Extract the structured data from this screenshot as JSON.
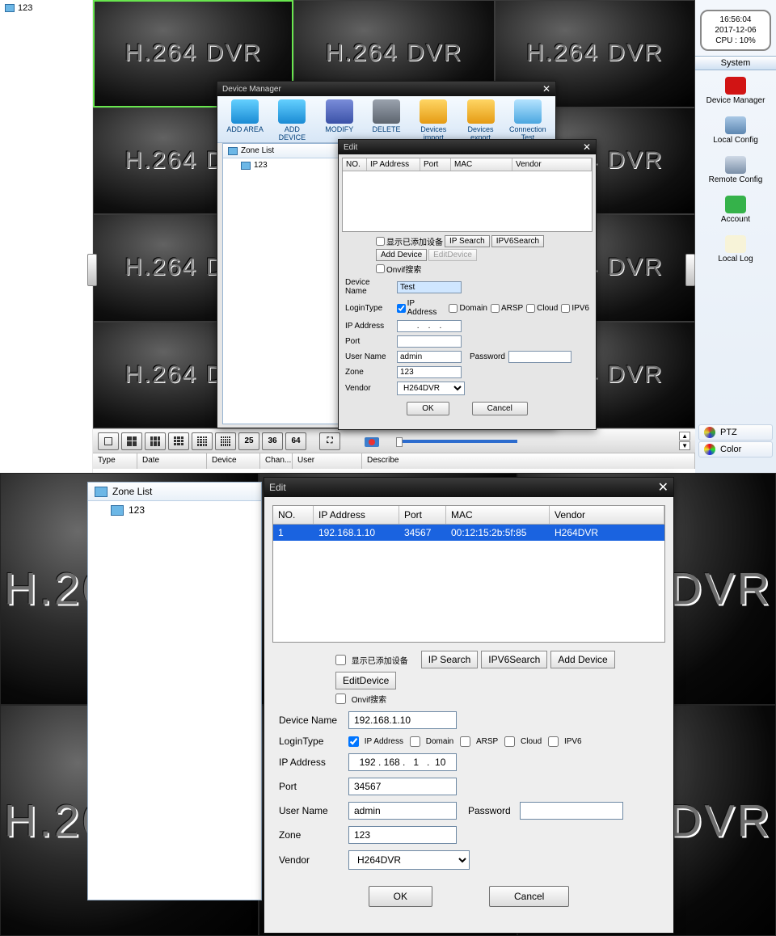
{
  "explorer": {
    "root": "123"
  },
  "clock": {
    "time": "16:56:04",
    "date": "2017-12-06",
    "cpu": "CPU : 10%"
  },
  "sysbar": {
    "header": "System",
    "items": [
      {
        "label": "Device Manager",
        "color": "#d11414"
      },
      {
        "label": "Local Config",
        "color": "linear-gradient(#a9c8e6,#5d86b1)"
      },
      {
        "label": "Remote Config",
        "color": "linear-gradient(#cfd9e6,#7a8fa8)"
      },
      {
        "label": "Account",
        "color": "#35b24a"
      },
      {
        "label": "Local Log",
        "color": "#f7f3d8"
      }
    ],
    "panels": [
      {
        "label": "PTZ",
        "dot": "conic-gradient(#d33,#3a3,#33d,#dd3,#d33)"
      },
      {
        "label": "Color",
        "dot": "conic-gradient(#e02,#2e2,#22e,#ee2,#e02)"
      }
    ]
  },
  "gridbar": {
    "numbers": [
      "25",
      "36",
      "64"
    ]
  },
  "loghdr": [
    "Type",
    "Date",
    "Device",
    "Chan...",
    "User",
    "Describe"
  ],
  "watermark": "H.264 DVR",
  "devmgr": {
    "title": "Device Manager",
    "toolbar": [
      {
        "label": "ADD AREA",
        "bg": "linear-gradient(#64d0ff,#1a8bd4)"
      },
      {
        "label": "ADD DEVICE",
        "bg": "linear-gradient(#64d0ff,#1a8bd4)"
      },
      {
        "label": "MODIFY",
        "bg": "linear-gradient(#7a8dd9,#3b52a8)"
      },
      {
        "label": "DELETE",
        "bg": "linear-gradient(#9aa2ad,#5d656f)"
      },
      {
        "label": "Devices import",
        "bg": "linear-gradient(#ffd664,#e59b14)"
      },
      {
        "label": "Devices export",
        "bg": "linear-gradient(#ffd664,#e59b14)"
      },
      {
        "label": "Connection Test",
        "bg": "linear-gradient(#b4e3ff,#4ba7e0)"
      }
    ],
    "zoneList": {
      "header": "Zone List",
      "items": [
        "123"
      ]
    }
  },
  "edit": {
    "title": "Edit",
    "columns": [
      "NO.",
      "IP Address",
      "Port",
      "MAC",
      "Vendor"
    ],
    "checks": {
      "showAdded": "显示已添加设备",
      "onvif": "Onvif搜索"
    },
    "buttons": {
      "ipsearch": "IP Search",
      "ip6": "IPV6Search",
      "add": "Add Device",
      "editdev": "EditDevice"
    },
    "labels": {
      "devName": "Device Name",
      "loginType": "LoginType",
      "ipaddr": "IP Address",
      "port": "Port",
      "user": "User Name",
      "pass": "Password",
      "zone": "Zone",
      "vendor": "Vendor"
    },
    "loginTypes": {
      "ip": "IP Address",
      "domain": "Domain",
      "arsp": "ARSP",
      "cloud": "Cloud",
      "ipv6": "IPV6"
    },
    "ok": "OK",
    "cancel": "Cancel"
  },
  "edit1": {
    "devName": "Test",
    "ip": "   .    .    .   ",
    "port": "",
    "user": "admin",
    "pass": "",
    "zone": "123",
    "vendor": "H264DVR",
    "ipChecked": true,
    "domainChecked": false,
    "arspChecked": false,
    "cloudChecked": false,
    "ipv6Checked": false
  },
  "edit2": {
    "row": {
      "no": "1",
      "ip": "192.168.1.10",
      "port": "34567",
      "mac": "00:12:15:2b:5f:85",
      "vendor": "H264DVR"
    },
    "devName": "192.168.1.10",
    "ip": "192 . 168 .   1   .  10",
    "port": "34567",
    "user": "admin",
    "pass": "",
    "zone": "123",
    "vendor": "H264DVR",
    "ipChecked": true,
    "domainChecked": false,
    "arspChecked": false,
    "cloudChecked": false,
    "ipv6Checked": false
  }
}
